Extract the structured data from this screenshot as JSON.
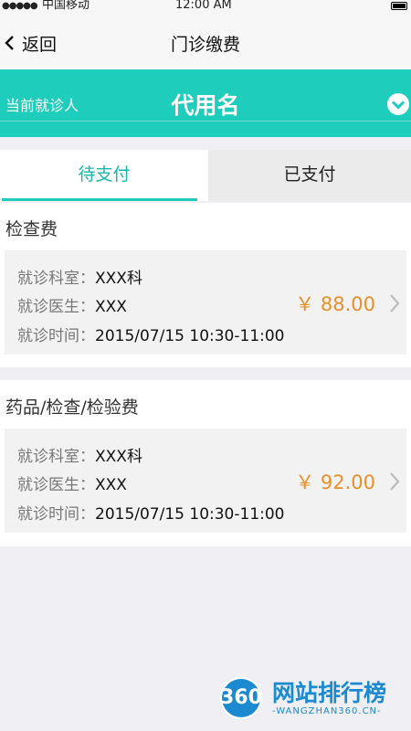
{
  "status_bar": {
    "signal": "●●●●●",
    "carrier": "中国移动",
    "time": "12:00 AM"
  },
  "nav": {
    "back_label": "返回",
    "title": "门诊缴费"
  },
  "patient": {
    "label": "当前就诊人",
    "name": "代用名"
  },
  "tabs": [
    {
      "label": "待支付",
      "active": true
    },
    {
      "label": "已支付",
      "active": false
    }
  ],
  "sections": [
    {
      "title": "检查费",
      "item": {
        "dept_key": "就诊科室：",
        "dept_val": "XXX科",
        "doctor_key": "就诊医生：",
        "doctor_val": "XXX",
        "time_key": "就诊时间：",
        "time_val": "2015/07/15 10:30-11:00",
        "price": "￥ 88.00"
      }
    },
    {
      "title": "药品/检查/检验费",
      "item": {
        "dept_key": "就诊科室：",
        "dept_val": "XXX科",
        "doctor_key": "就诊医生：",
        "doctor_val": "XXX",
        "time_key": "就诊时间：",
        "time_val": "2015/07/15 10:30-11:00",
        "price": "￥ 92.00"
      }
    }
  ],
  "watermark": {
    "logo_text": "360",
    "title": "网站排行榜",
    "subtitle": "-WANGZHAN360.CN-"
  },
  "colors": {
    "accent": "#1ecdbc",
    "price": "#e8902a",
    "background": "#efeff4"
  }
}
